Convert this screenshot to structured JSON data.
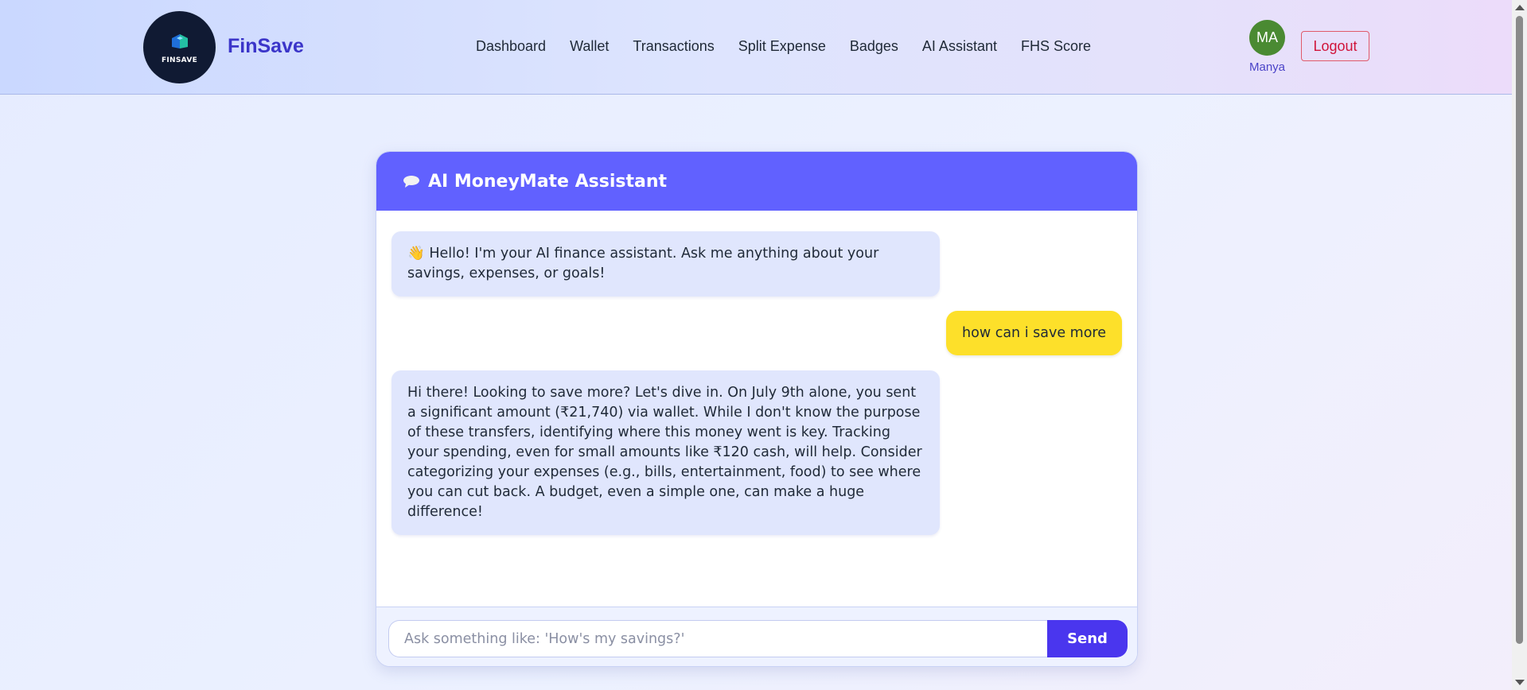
{
  "header": {
    "logo_text": "FINSAVE",
    "brand": "FinSave",
    "nav": [
      "Dashboard",
      "Wallet",
      "Transactions",
      "Split Expense",
      "Badges",
      "AI Assistant",
      "FHS Score"
    ],
    "user": {
      "initials": "MA",
      "name": "Manya",
      "avatar_color": "#4a8a32"
    },
    "logout_label": "Logout"
  },
  "chat": {
    "title": "AI MoneyMate Assistant",
    "title_icon": "speech-bubble-icon",
    "messages": [
      {
        "role": "assistant",
        "text": "👋 Hello! I'm your AI finance assistant. Ask me anything about your savings, expenses, or goals!"
      },
      {
        "role": "user",
        "text": "how can i save more"
      },
      {
        "role": "assistant",
        "text": "Hi there! Looking to save more? Let's dive in. On July 9th alone, you sent a significant amount (₹21,740) via wallet. While I don't know the purpose of these transfers, identifying where this money went is key. Tracking your spending, even for small amounts like ₹120 cash, will help. Consider categorizing your expenses (e.g., bills, entertainment, food) to see where you can cut back. A budget, even a simple one, can make a huge difference!"
      }
    ],
    "input_placeholder": "Ask something like: 'How's my savings?'",
    "input_value": "",
    "send_label": "Send"
  },
  "colors": {
    "accent": "#6161ff",
    "send_button": "#4a36ee",
    "assistant_bubble": "#e0e6fd",
    "user_bubble": "#fde02a",
    "brand_text": "#3b35c9",
    "logout": "#d0143a"
  }
}
